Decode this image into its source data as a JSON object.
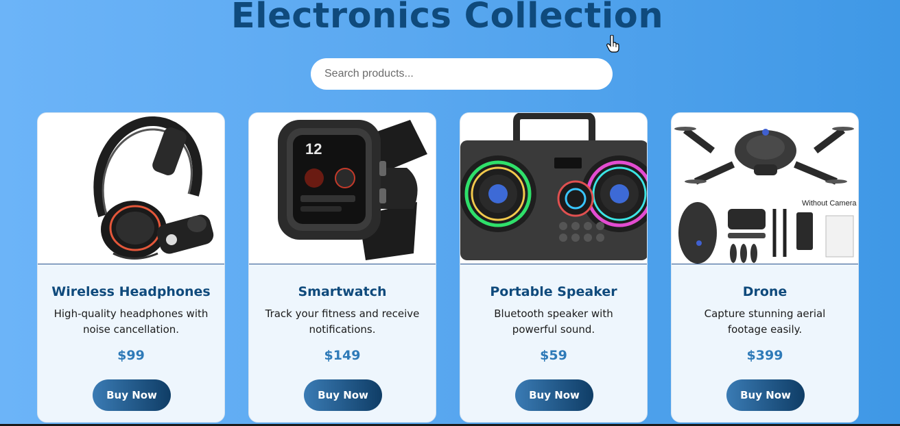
{
  "header": {
    "title": "Electronics Collection"
  },
  "search": {
    "placeholder": "Search products..."
  },
  "products": [
    {
      "name": "Wireless Headphones",
      "description": "High-quality headphones with noise cancellation.",
      "price": "$99",
      "button_label": "Buy Now",
      "image": "headphones"
    },
    {
      "name": "Smartwatch",
      "description": "Track your fitness and receive notifications.",
      "price": "$149",
      "button_label": "Buy Now",
      "image": "smartwatch"
    },
    {
      "name": "Portable Speaker",
      "description": "Bluetooth speaker with powerful sound.",
      "price": "$59",
      "button_label": "Buy Now",
      "image": "speaker"
    },
    {
      "name": "Drone",
      "description": "Capture stunning aerial footage easily.",
      "price": "$399",
      "button_label": "Buy Now",
      "image": "drone",
      "image_caption": "Without Camera"
    }
  ],
  "colors": {
    "title": "#0f4a7c",
    "price": "#2e7ab8",
    "button_start": "#3a7bb4",
    "button_end": "#0f3d66"
  }
}
